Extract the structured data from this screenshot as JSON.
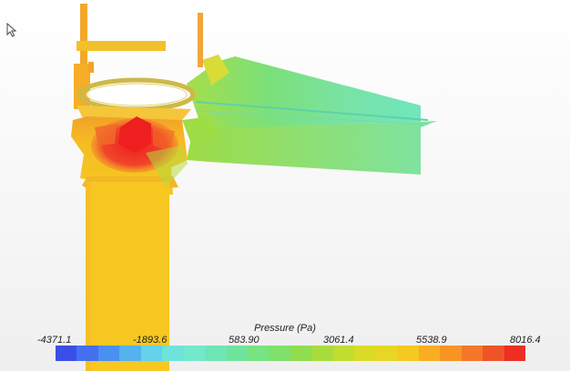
{
  "legend": {
    "title": "Pressure (Pa)",
    "labels": [
      "-4371.1",
      "-1893.6",
      "583.90",
      "3061.4",
      "5538.9",
      "8016.4"
    ]
  },
  "colormap": [
    "#3a4fe8",
    "#4470f0",
    "#4a90f2",
    "#55b2ef",
    "#63d2ea",
    "#6de3dc",
    "#74e8cb",
    "#6ee6b5",
    "#6fe49c",
    "#78e383",
    "#80e06b",
    "#90dd4f",
    "#a8dc3c",
    "#c2dc2f",
    "#dadb27",
    "#e8d624",
    "#f5c920",
    "#f8ae20",
    "#f89423",
    "#f47827",
    "#ef5427",
    "#ec2e23"
  ],
  "colors": {
    "inlet_pipe": "#f7be22",
    "outlet_duct": "#7ae38c",
    "high_pressure": "#ef2a22",
    "frame": "#f4a82a"
  }
}
